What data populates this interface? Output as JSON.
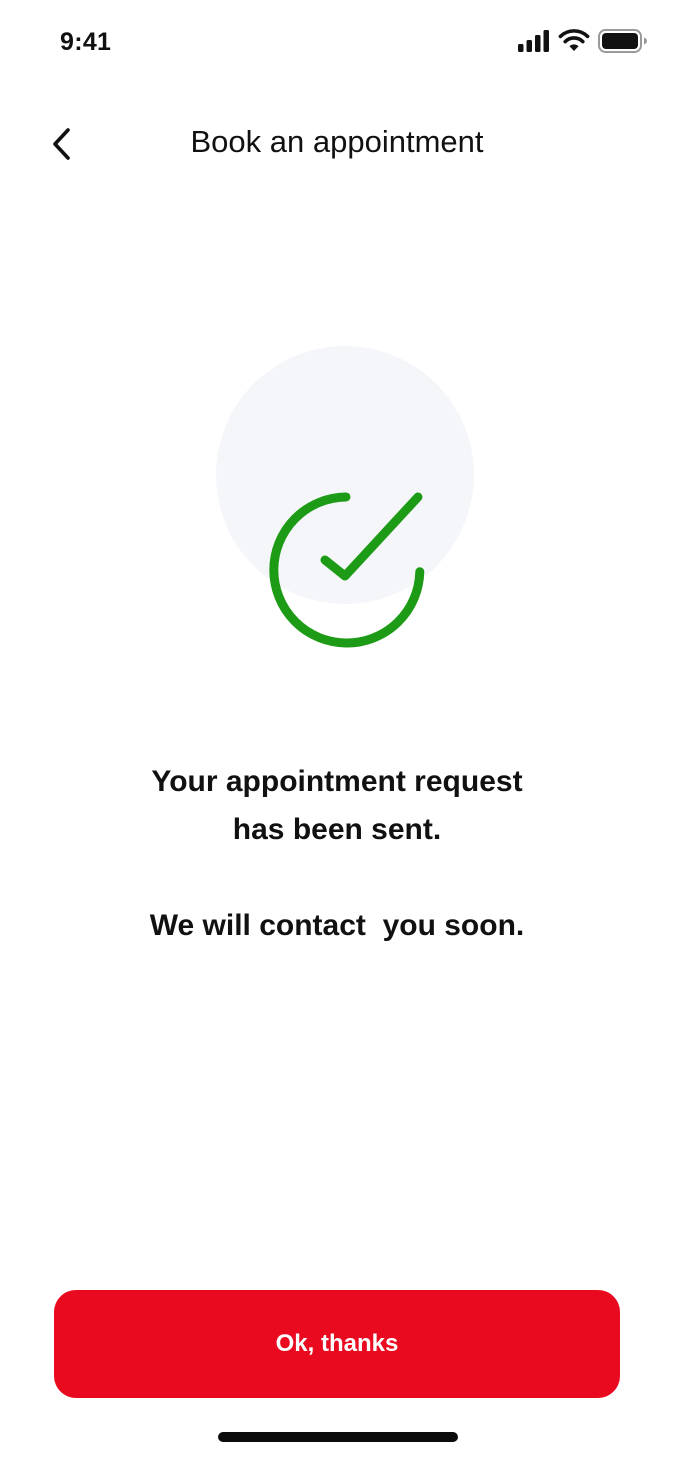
{
  "status_bar": {
    "time": "9:41",
    "icons": [
      "cellular-signal-icon",
      "wifi-icon",
      "battery-icon"
    ]
  },
  "header": {
    "back_icon": "chevron-left-icon",
    "title": "Book an appointment"
  },
  "illustration": {
    "icon": "success-check-icon",
    "circle_color": "#f4f6f9",
    "check_color": "#1e9b16"
  },
  "confirmation": {
    "line1": "Your appointment request",
    "line2": "has been sent.",
    "line3": "We will contact  you soon."
  },
  "actions": {
    "primary_label": "Ok, thanks",
    "primary_color": "#e90a20"
  }
}
